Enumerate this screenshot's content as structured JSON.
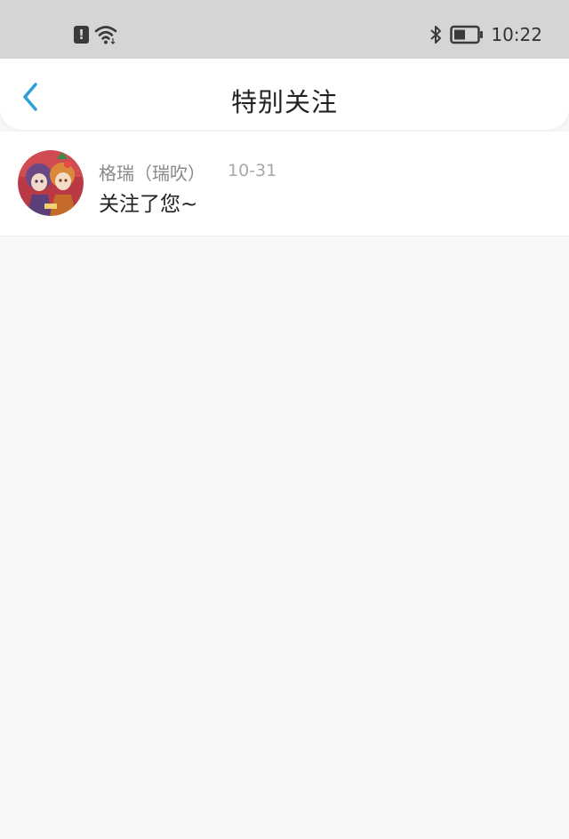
{
  "status_bar": {
    "time": "10:22",
    "alert_icon_glyph": "!",
    "icons": [
      "alert-icon",
      "wifi-icon",
      "bluetooth-icon",
      "battery-icon"
    ]
  },
  "header": {
    "title": "特别关注",
    "back_icon": "chevron-left-icon",
    "accent_color": "#2a9fd8"
  },
  "notifications": [
    {
      "name": "格瑞（瑞吹）",
      "date": "10-31",
      "message": "关注了您~"
    }
  ],
  "colors": {
    "status_bar_bg": "#d5d5d5",
    "page_bg": "#f8f6f7",
    "card_bg": "#ffffff"
  }
}
